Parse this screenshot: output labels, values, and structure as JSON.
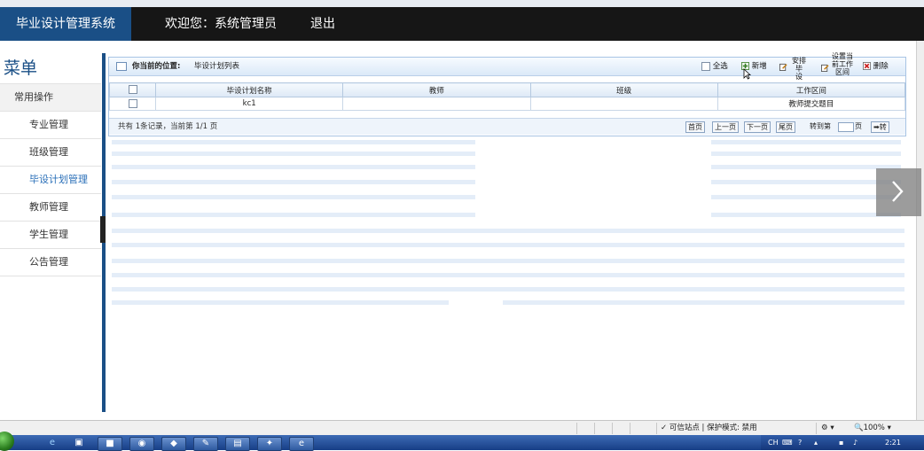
{
  "header": {
    "app_title": "毕业设计管理系统",
    "welcome": "欢迎您：系统管理员",
    "logout": "退出"
  },
  "sidebar": {
    "title": "菜单",
    "section": "常用操作",
    "items": [
      {
        "label": "专业管理"
      },
      {
        "label": "班级管理"
      },
      {
        "label": "毕设计划管理",
        "active": true
      },
      {
        "label": "教师管理"
      },
      {
        "label": "学生管理"
      },
      {
        "label": "公告管理"
      }
    ]
  },
  "panel": {
    "location_label": "你当前的位置:",
    "location_path": "毕设计划列表",
    "toolbar": {
      "select_all": "全选",
      "add": "新增",
      "arrange_line1": "安排毕",
      "arrange_line2": "设",
      "set_line1": "设置当",
      "set_line2": "前工作",
      "set_line3": "区间",
      "delete": "删除"
    }
  },
  "table": {
    "columns": [
      "毕设计划名称",
      "教师",
      "班级",
      "工作区间"
    ],
    "rows": [
      {
        "name": "kc1",
        "teacher": "",
        "class": "",
        "period": "教师提交题目"
      }
    ]
  },
  "pagination": {
    "info": "共有 1条记录，当前第 1/1 页",
    "first": "首页",
    "prev": "上一页",
    "next": "下一页",
    "last": "尾页",
    "goto_prefix": "转到第",
    "goto_suffix": "页",
    "go": "➡转"
  },
  "statusbar": {
    "trusted": "✓ 可信站点 | 保护模式: 禁用",
    "zoom": "🔍100%  ▾"
  },
  "taskbar": {
    "tray_lang": "CH",
    "clock": "2:21"
  },
  "colors": {
    "brand": "#1a4f86",
    "header_bg": "#161616",
    "panel_border": "#a8c4e4",
    "active_item": "#2a6fb8"
  }
}
